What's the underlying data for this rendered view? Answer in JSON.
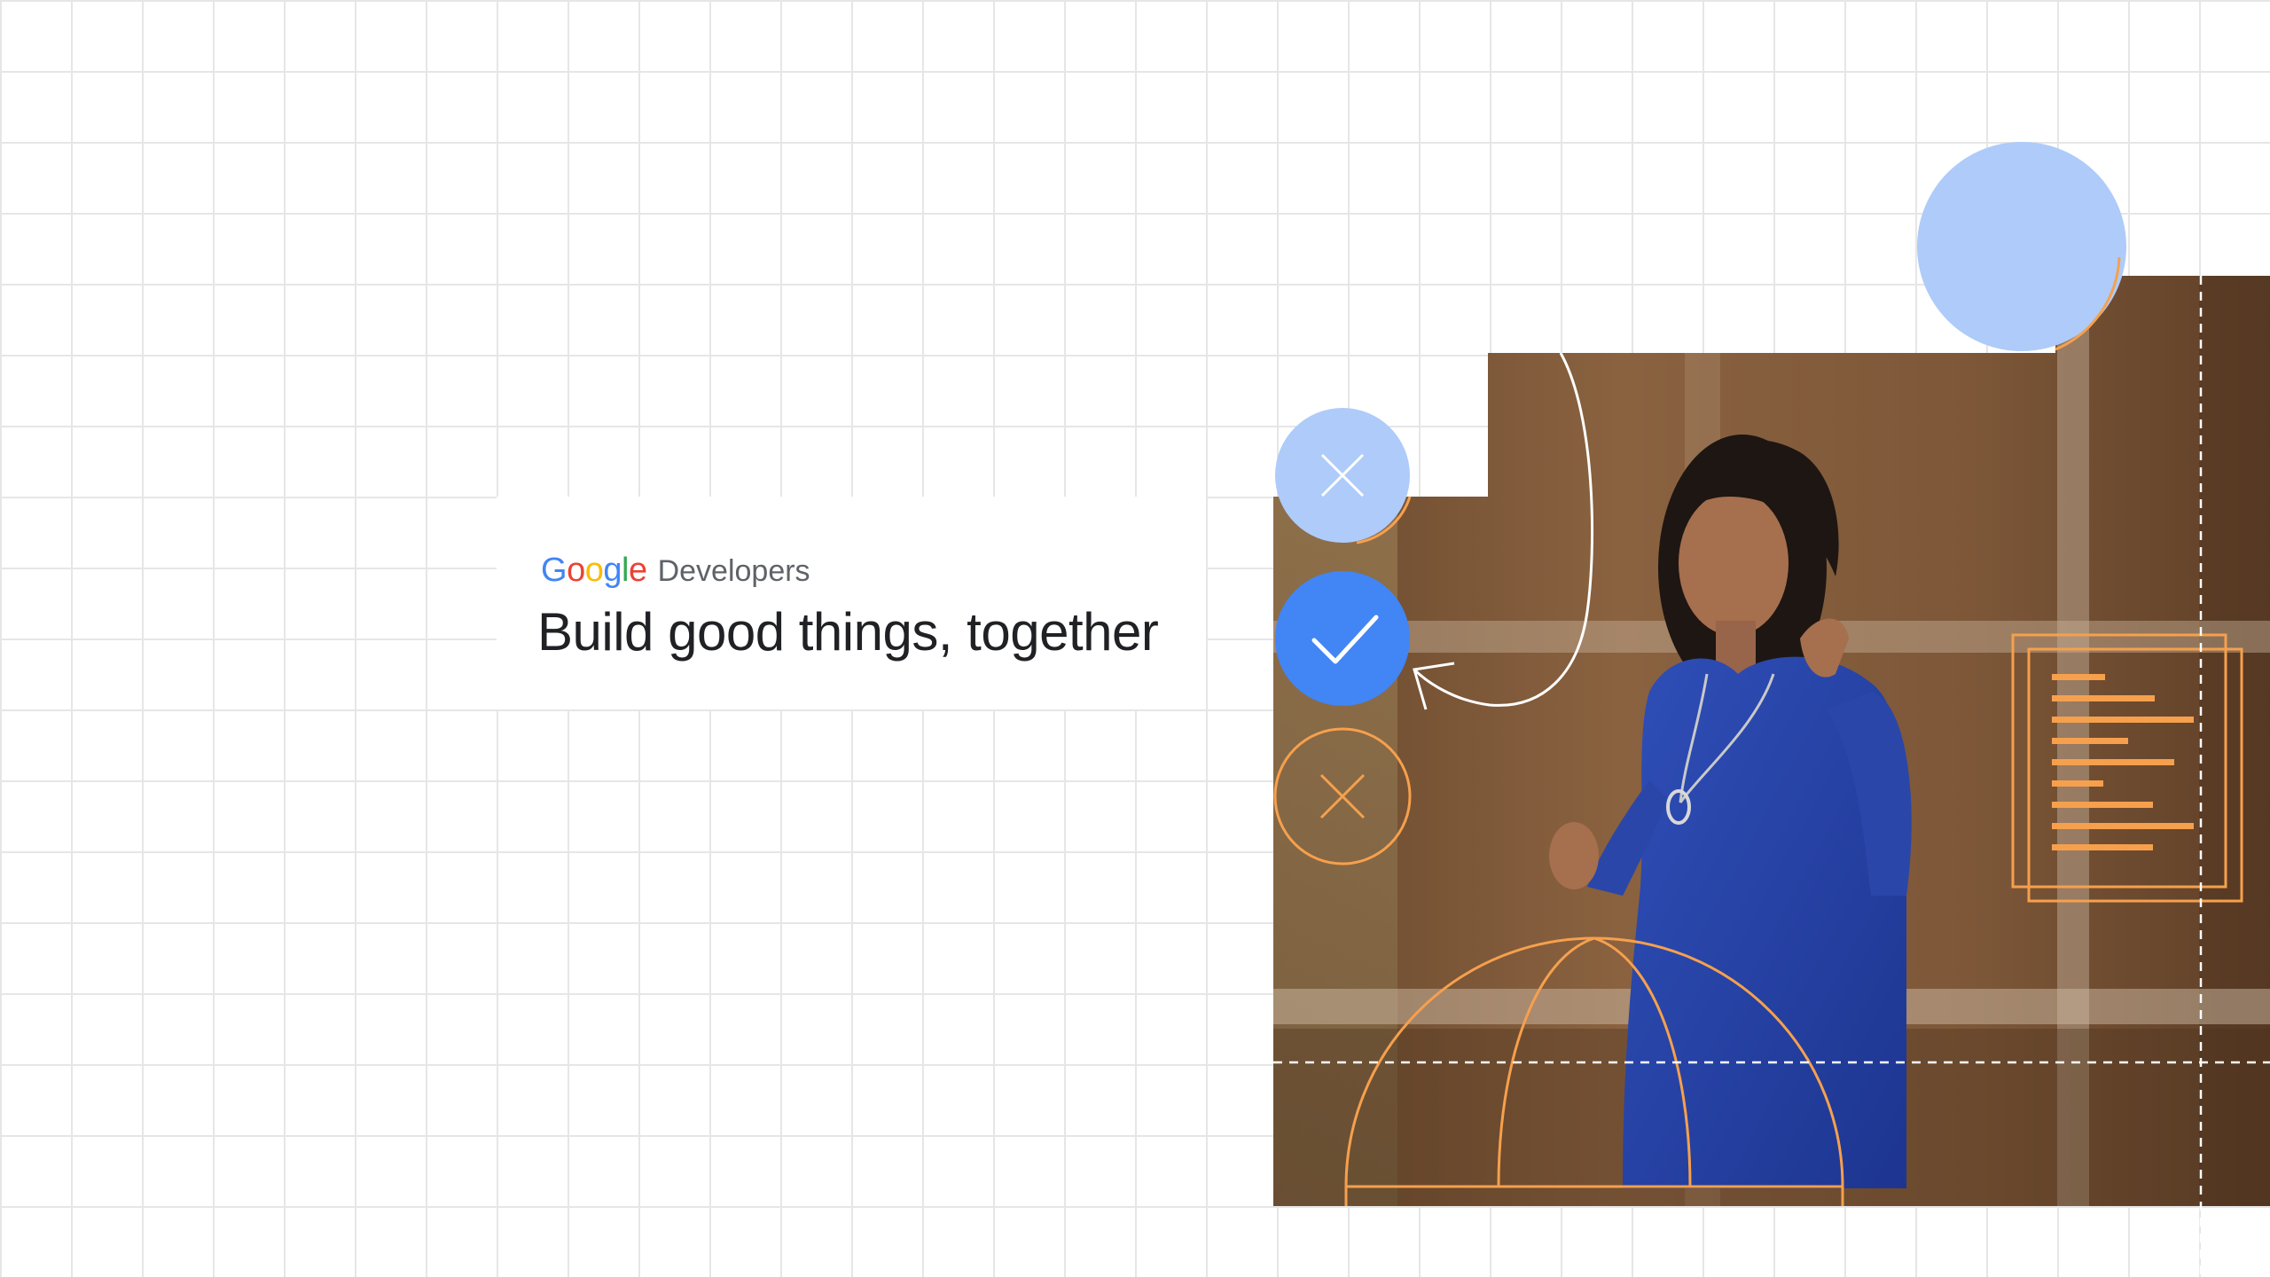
{
  "brand": {
    "logo_letters": [
      {
        "char": "G",
        "color": "#4285F4"
      },
      {
        "char": "o",
        "color": "#EA4335"
      },
      {
        "char": "o",
        "color": "#FBBC04"
      },
      {
        "char": "g",
        "color": "#4285F4"
      },
      {
        "char": "l",
        "color": "#34A853"
      },
      {
        "char": "e",
        "color": "#EA4335"
      }
    ],
    "product": "Developers"
  },
  "headline": "Build good things, together",
  "colors": {
    "blue_light": "#AECBFA",
    "blue": "#4285F4",
    "orange": "#F6A04D",
    "grid": "#E6E6E6"
  },
  "icons": [
    "close-icon",
    "check-icon",
    "close-icon",
    "document-icon"
  ]
}
